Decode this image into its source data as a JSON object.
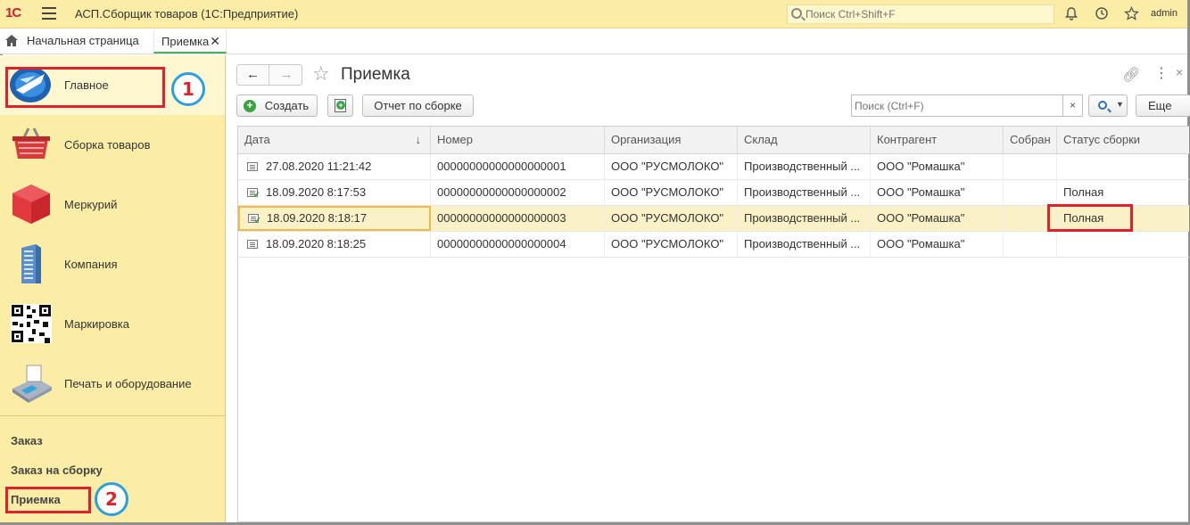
{
  "app": {
    "logo": "1С",
    "title": "АСП.Сборщик товаров  (1С:Предприятие)",
    "search_placeholder": "Поиск Ctrl+Shift+F",
    "user": "admin"
  },
  "tabs": {
    "home_label": "Начальная страница",
    "active_label": "Приемка"
  },
  "sidebar": {
    "sections": [
      {
        "label": "Главное",
        "icon": "main-section-icon"
      },
      {
        "label": "Сборка товаров",
        "icon": "basket-icon"
      },
      {
        "label": "Меркурий",
        "icon": "red-cube-icon"
      },
      {
        "label": "Компания",
        "icon": "building-icon"
      },
      {
        "label": "Маркировка",
        "icon": "qr-code-icon"
      },
      {
        "label": "Печать и оборудование",
        "icon": "pos-terminal-icon"
      }
    ],
    "links": [
      {
        "label": "Заказ"
      },
      {
        "label": "Заказ на сборку"
      },
      {
        "label": "Приемка"
      }
    ]
  },
  "annotations": {
    "marker1": "1",
    "marker2": "2"
  },
  "form": {
    "title": "Приемка",
    "create_label": "Создать",
    "report_label": "Отчет по сборке",
    "search_placeholder": "Поиск (Ctrl+F)",
    "clear_label": "×",
    "more_label": "Еще"
  },
  "table": {
    "columns": [
      "Дата",
      "Номер",
      "Организация",
      "Склад",
      "Контрагент",
      "Собран",
      "Статус сборки"
    ],
    "sort_indicator": "↓",
    "rows": [
      {
        "date": "27.08.2020 11:21:42",
        "number": "00000000000000000001",
        "org": "ООО \"РУСМОЛОКО\"",
        "warehouse": "Производственный ...",
        "counterparty": "ООО \"Ромашка\"",
        "collected": "",
        "status": "",
        "posted": false
      },
      {
        "date": "18.09.2020 8:17:53",
        "number": "00000000000000000002",
        "org": "ООО \"РУСМОЛОКО\"",
        "warehouse": "Производственный ...",
        "counterparty": "ООО \"Ромашка\"",
        "collected": "",
        "status": "Полная",
        "posted": true
      },
      {
        "date": "18.09.2020 8:18:17",
        "number": "00000000000000000003",
        "org": "ООО \"РУСМОЛОКО\"",
        "warehouse": "Производственный ...",
        "counterparty": "ООО \"Ромашка\"",
        "collected": "",
        "status": "Полная",
        "posted": true
      },
      {
        "date": "18.09.2020 8:18:25",
        "number": "00000000000000000004",
        "org": "ООО \"РУСМОЛОКО\"",
        "warehouse": "Производственный ...",
        "counterparty": "ООО \"Ромашка\"",
        "collected": "",
        "status": "",
        "posted": false
      }
    ]
  }
}
